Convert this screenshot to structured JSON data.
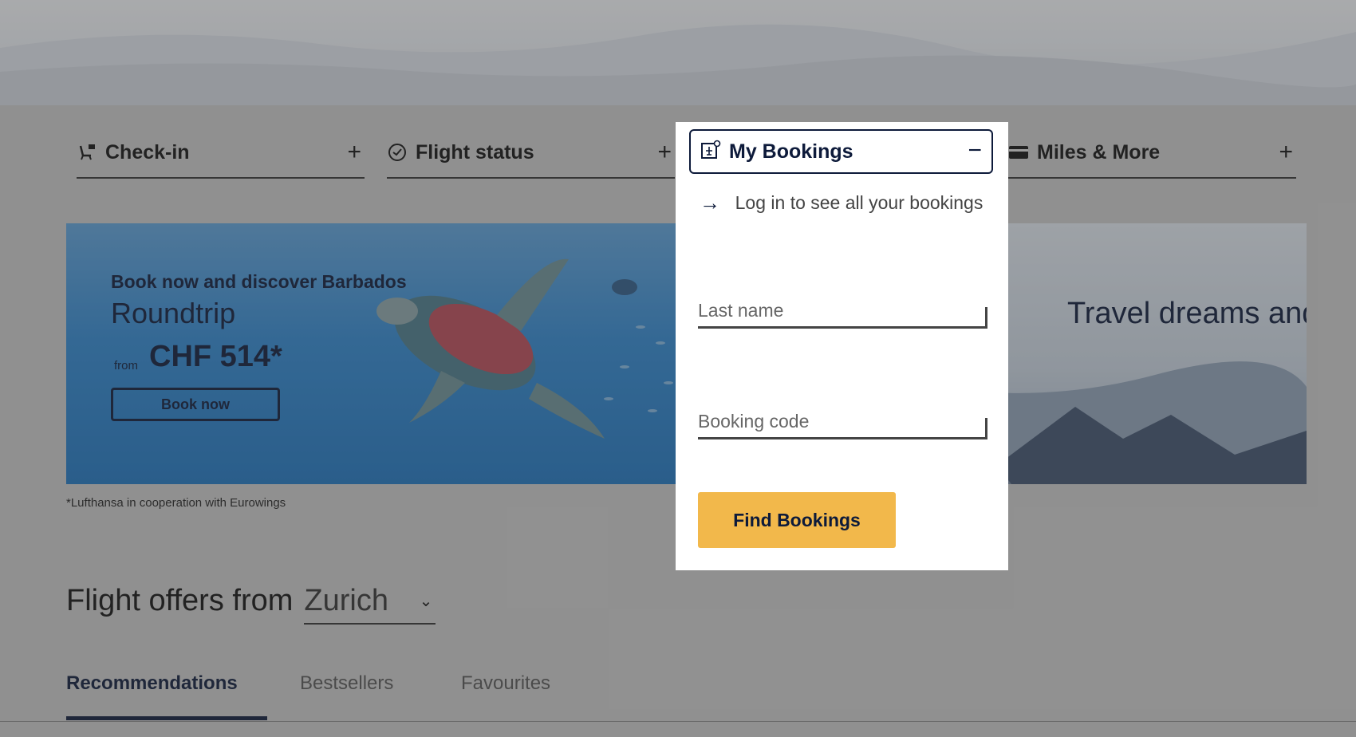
{
  "quick_access": {
    "checkin": {
      "label": "Check-in",
      "icon": "seat-icon"
    },
    "flight_status": {
      "label": "Flight status",
      "icon": "clock-icon"
    },
    "my_bookings": {
      "label": "My Bookings",
      "icon": "booking-icon"
    },
    "miles": {
      "label": "Miles & More",
      "icon": "card-icon"
    }
  },
  "promo": {
    "kicker": "Book now and discover Barbados",
    "title": "Roundtrip",
    "from": "from",
    "price": "CHF 514*",
    "button": "Book now",
    "right_title": "Travel dreams and budget projects",
    "footnote": "*Lufthansa in cooperation with Eurowings"
  },
  "offers": {
    "heading": "Flight offers from",
    "city": "Zurich"
  },
  "tabs": [
    "Recommendations",
    "Bestsellers",
    "Favourites"
  ],
  "bookings_panel": {
    "login_text": "Log in to see all your bookings",
    "last_name_placeholder": "Last name",
    "booking_code_placeholder": "Booking code",
    "find_button": "Find Bookings"
  },
  "colors": {
    "accent": "#f2b84b",
    "navy": "#0d1a3a"
  }
}
